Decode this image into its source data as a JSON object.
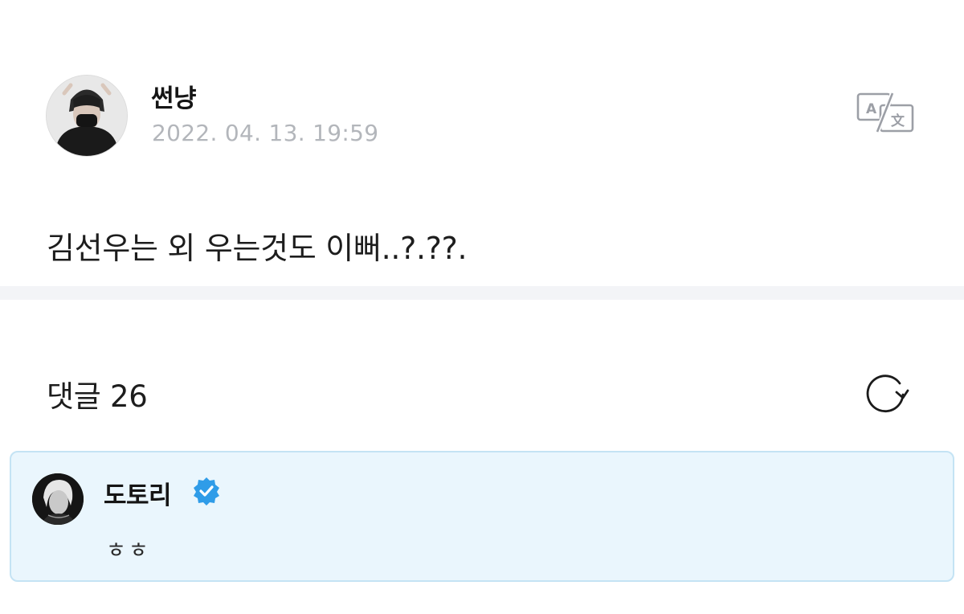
{
  "post": {
    "author": "썬냥",
    "timestamp": "2022. 04. 13. 19:59",
    "body": "김선우는 외 우는것도 이뻐..?.??.",
    "translate_icon": "translate-icon"
  },
  "comments": {
    "label": "댓글",
    "count": "26",
    "refresh_icon": "refresh-icon",
    "items": [
      {
        "author": "도토리",
        "verified": true,
        "text": "ㅎㅎ"
      }
    ]
  },
  "colors": {
    "timestamp": "#b3b6bb",
    "divider": "#f3f4f7",
    "comment_highlight_bg": "#eaf6fd",
    "comment_highlight_border": "#c4e3f4",
    "verified_badge": "#2f9ce8"
  }
}
